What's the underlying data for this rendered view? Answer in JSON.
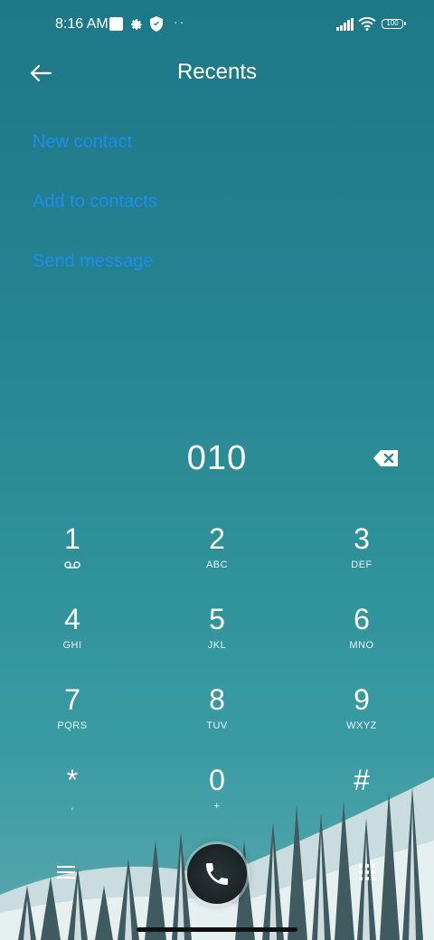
{
  "status_bar": {
    "time": "8:16 AM",
    "battery": "100",
    "icons": [
      "notification-square",
      "gear-icon",
      "shield-icon",
      "more-dots",
      "signal-icon",
      "wifi-icon",
      "battery-icon"
    ]
  },
  "header": {
    "title": "Recents",
    "back_icon": "back-arrow-icon"
  },
  "actions": [
    {
      "label": "New contact"
    },
    {
      "label": "Add to contacts"
    },
    {
      "label": "Send message"
    }
  ],
  "dialer": {
    "number": "010",
    "keys": [
      {
        "digit": "1",
        "letters": ""
      },
      {
        "digit": "2",
        "letters": "ABC"
      },
      {
        "digit": "3",
        "letters": "DEF"
      },
      {
        "digit": "4",
        "letters": "GHI"
      },
      {
        "digit": "5",
        "letters": "JKL"
      },
      {
        "digit": "6",
        "letters": "MNO"
      },
      {
        "digit": "7",
        "letters": "PQRS"
      },
      {
        "digit": "8",
        "letters": "TUV"
      },
      {
        "digit": "9",
        "letters": "WXYZ"
      },
      {
        "digit": "*",
        "letters": ","
      },
      {
        "digit": "0",
        "letters": "+"
      },
      {
        "digit": "#",
        "letters": ""
      }
    ]
  },
  "colors": {
    "accent_link": "#1e8cf0",
    "background_top": "#1d7888",
    "background_bottom": "#5aa8ad"
  }
}
